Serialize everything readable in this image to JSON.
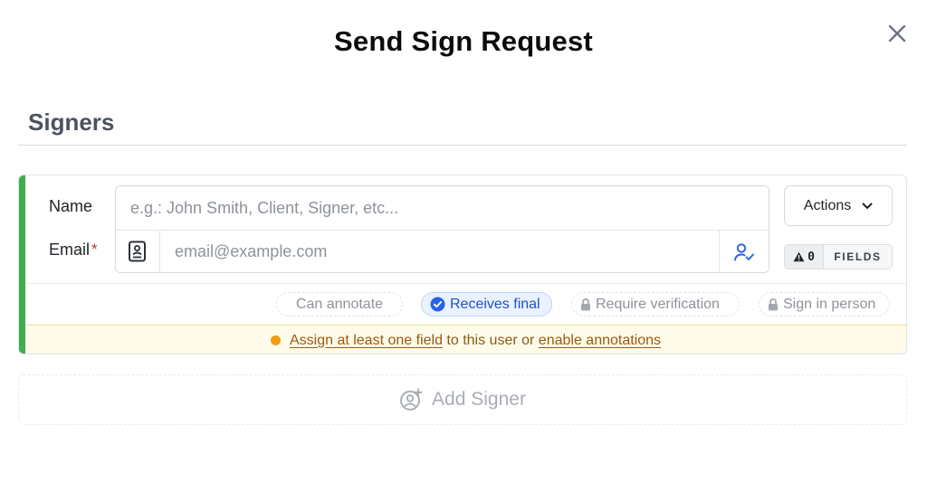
{
  "modal": {
    "title": "Send Sign Request"
  },
  "section": {
    "title": "Signers"
  },
  "signer": {
    "name_label": "Name",
    "email_label": "Email",
    "required_mark": "*",
    "name_placeholder": "e.g.: John Smith, Client, Signer, etc...",
    "email_placeholder": "email@example.com",
    "actions_label": "Actions",
    "fields_count": "0",
    "fields_label": "FIELDS",
    "accent_color": "#3fae4e",
    "options": {
      "can_annotate": "Can annotate",
      "receives_final": "Receives final",
      "require_verification": "Require verification",
      "sign_in_person": "Sign in person"
    },
    "warning": {
      "link1": "Assign at least one field",
      "text_middle": " to this user or ",
      "link2": "enable annotations"
    }
  },
  "add_signer": {
    "label": "Add Signer"
  }
}
